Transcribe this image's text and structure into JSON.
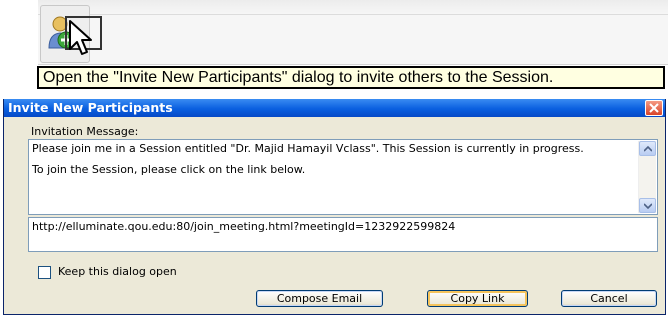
{
  "tooltip": {
    "text": "Open the \"Invite New Participants\" dialog to invite others to the Session."
  },
  "dialog": {
    "title": "Invite New Participants",
    "invitation_label": "Invitation Message:",
    "message_paragraphs": [
      "Please join me in a Session entitled \"Dr. Majid Hamayil Vclass\". This Session is currently in progress.",
      "To join the Session, please click on the link below."
    ],
    "link": "http://elluminate.qou.edu:80/join_meeting.html?meetingId=1232922599824",
    "keep_open_label": "Keep this dialog open",
    "keep_open_checked": false,
    "buttons": {
      "compose_email": "Compose Email",
      "copy_link": "Copy Link",
      "cancel": "Cancel"
    }
  },
  "colors": {
    "titlebar": "#0a5fe0",
    "dialog_bg": "#ece9d8",
    "tooltip_bg": "#ffffe1",
    "close_button": "#d9442a"
  },
  "icons": [
    "invite-participants-icon",
    "cursor-icon",
    "close-icon",
    "scroll-up-icon",
    "scroll-down-icon"
  ]
}
